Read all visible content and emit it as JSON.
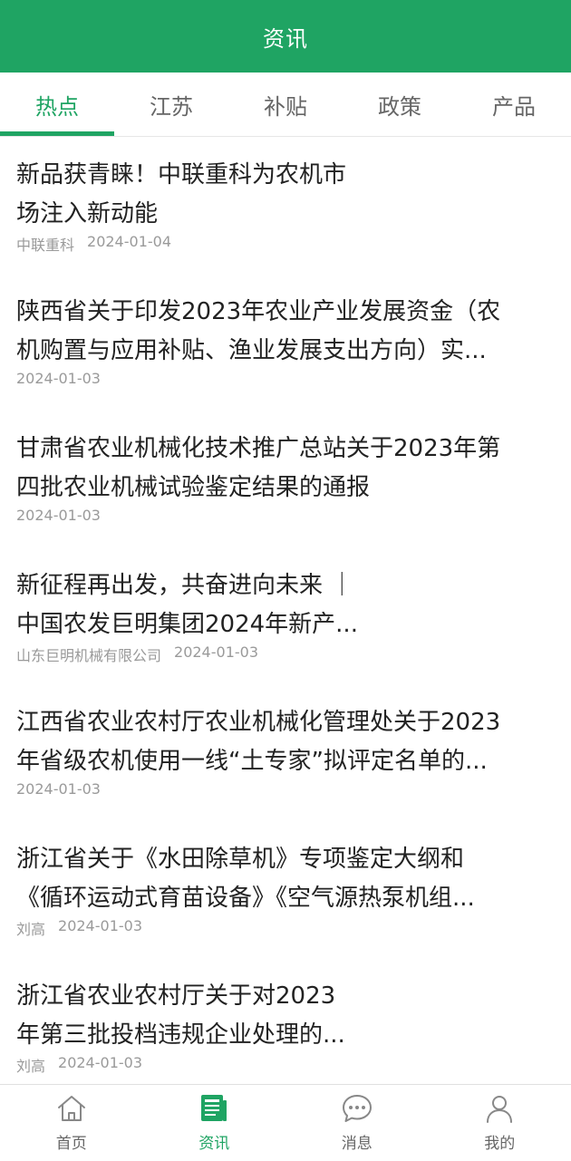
{
  "header": {
    "title": "资讯"
  },
  "tabs": [
    {
      "label": "热点",
      "active": true
    },
    {
      "label": "江苏",
      "active": false
    },
    {
      "label": "补贴",
      "active": false
    },
    {
      "label": "政策",
      "active": false
    },
    {
      "label": "产品",
      "active": false
    }
  ],
  "news": [
    {
      "title": "新品获青睐！中联重科为农机市\n场注入新动能",
      "source": "中联重科",
      "date": "2024-01-04"
    },
    {
      "title": "陕西省关于印发2023年农业产业发展资金（农\n机购置与应用补贴、渔业发展支出方向）实...",
      "source": "",
      "date": "2024-01-03"
    },
    {
      "title": "甘肃省农业机械化技术推广总站关于2023年第\n四批农业机械试验鉴定结果的通报",
      "source": "",
      "date": "2024-01-03"
    },
    {
      "title": "新征程再出发，共奋进向未来 ｜\n中国农发巨明集团2024年新产...",
      "source": "山东巨明机械有限公司",
      "date": "2024-01-03"
    },
    {
      "title": "江西省农业农村厅农业机械化管理处关于2023\n年省级农机使用一线“土专家”拟评定名单的...",
      "source": "",
      "date": "2024-01-03"
    },
    {
      "title": "浙江省关于《水田除草机》专项鉴定大纲和\n《循环运动式育苗设备》《空气源热泵机组...",
      "source": "刘高",
      "date": "2024-01-03"
    },
    {
      "title": "浙江省农业农村厅关于对2023\n年第三批投档违规企业处理的...",
      "source": "刘高",
      "date": "2024-01-03"
    }
  ],
  "bottom_nav": [
    {
      "label": "首页",
      "icon": "home-icon",
      "active": false
    },
    {
      "label": "资讯",
      "icon": "news-icon",
      "active": true
    },
    {
      "label": "消息",
      "icon": "message-icon",
      "active": false
    },
    {
      "label": "我的",
      "icon": "user-icon",
      "active": false
    }
  ],
  "colors": {
    "accent": "#1fa463",
    "text": "#222222",
    "muted": "#9a9a9a"
  }
}
